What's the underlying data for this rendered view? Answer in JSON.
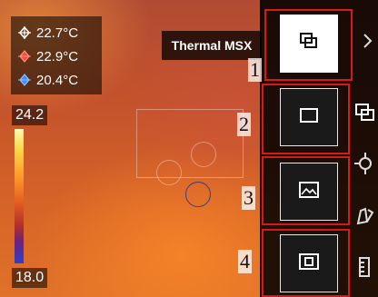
{
  "temps": {
    "center": "22.7°C",
    "max": "22.9°C",
    "min": "20.4°C",
    "center_color": "#ffffff",
    "max_color": "#ff4a3a",
    "min_color": "#3a8fff"
  },
  "scale": {
    "max": "24.2",
    "min": "18.0"
  },
  "mode_tooltip": "Thermal MSX",
  "modes": [
    {
      "number": "1",
      "icon": "thermal-msx-icon",
      "selected": true
    },
    {
      "number": "2",
      "icon": "thermal-icon",
      "selected": false
    },
    {
      "number": "3",
      "icon": "visual-image-icon",
      "selected": false
    },
    {
      "number": "4",
      "icon": "picture-in-picture-icon",
      "selected": false
    }
  ],
  "side_icons": [
    "chevron-right-icon",
    "layers-icon",
    "crosshair-icon",
    "palette-icon",
    "ruler-icon"
  ],
  "colors": {
    "annotation_red": "#d51a1a",
    "panel_bg": "#000000"
  }
}
